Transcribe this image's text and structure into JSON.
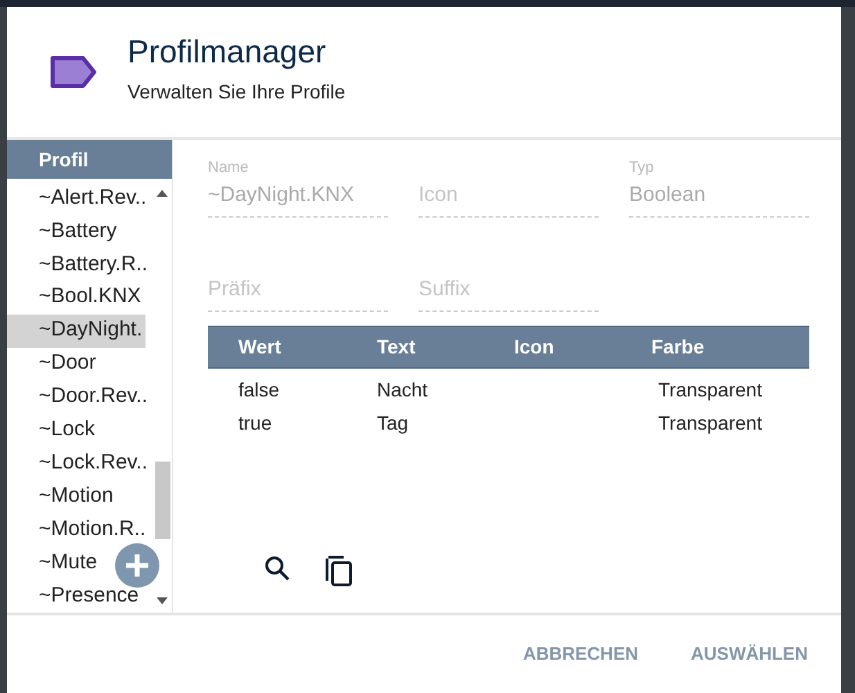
{
  "dialog": {
    "title": "Profilmanager",
    "subtitle": "Verwalten Sie Ihre Profile"
  },
  "sidebar": {
    "heading": "Profil",
    "items": [
      {
        "label": "~Alert.Rev..",
        "selected": false
      },
      {
        "label": "~Battery",
        "selected": false
      },
      {
        "label": "~Battery.R..",
        "selected": false
      },
      {
        "label": "~Bool.KNX",
        "selected": false
      },
      {
        "label": "~DayNight.",
        "selected": true
      },
      {
        "label": "~Door",
        "selected": false
      },
      {
        "label": "~Door.Rev..",
        "selected": false
      },
      {
        "label": "~Lock",
        "selected": false
      },
      {
        "label": "~Lock.Rev..",
        "selected": false
      },
      {
        "label": "~Motion",
        "selected": false
      },
      {
        "label": "~Motion.R..",
        "selected": false
      },
      {
        "label": "~Mute",
        "selected": false
      },
      {
        "label": "~Presence",
        "selected": false
      }
    ]
  },
  "fields": [
    {
      "label": "Name",
      "value": "~DayNight.KNX"
    },
    {
      "placeholder": "Icon"
    },
    {
      "label": "Typ",
      "value": "Boolean"
    },
    {
      "placeholder": "Präfix"
    },
    {
      "placeholder": "Suffix"
    }
  ],
  "table": {
    "columns": [
      "Wert",
      "Text",
      "Icon",
      "Farbe"
    ],
    "rows": [
      [
        "false",
        "Nacht",
        "",
        "Transparent"
      ],
      [
        "true",
        "Tag",
        "",
        "Transparent"
      ]
    ]
  },
  "buttons": [
    "ABBRECHEN",
    "AUSWÄHLEN"
  ]
}
